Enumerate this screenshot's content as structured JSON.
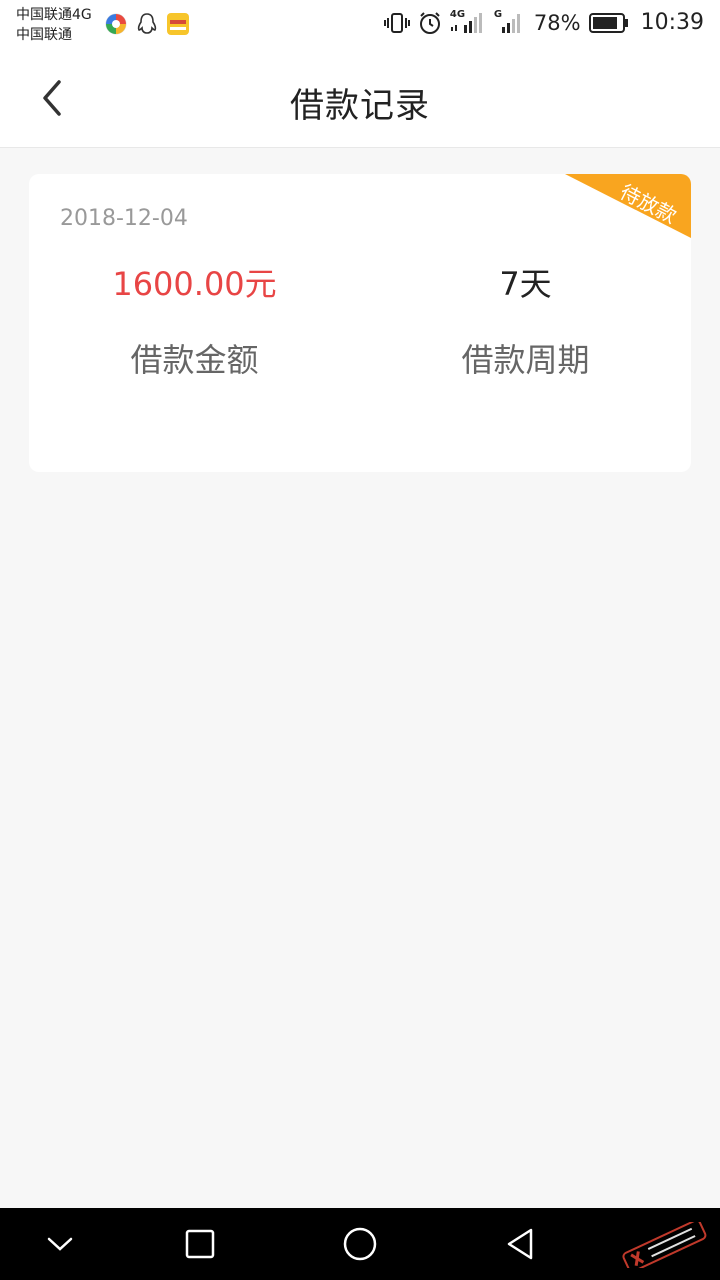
{
  "status_bar": {
    "carrier_1": "中国联通4G",
    "carrier_2": "中国联通",
    "signal_label_1": "4G",
    "signal_label_2": "G",
    "battery_percent": "78%",
    "time": "10:39"
  },
  "header": {
    "title": "借款记录"
  },
  "loan_record": {
    "date": "2018-12-04",
    "status_badge": "待放款",
    "amount": "1600.00元",
    "amount_label": "借款金额",
    "period": "7天",
    "period_label": "借款周期"
  },
  "colors": {
    "accent_red": "#e84545",
    "badge_orange": "#f9a51f"
  }
}
